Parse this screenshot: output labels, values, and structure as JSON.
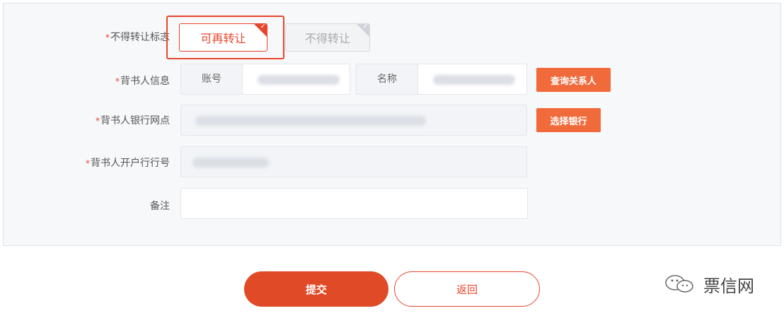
{
  "form": {
    "transfer_flag": {
      "label": "不得转让标志",
      "options": [
        "可再转让",
        "不得转让"
      ],
      "selected": "可再转让"
    },
    "endorser_info": {
      "label": "背书人信息",
      "account_prefix": "账号",
      "name_prefix": "名称",
      "button": "查询关系人"
    },
    "endorser_bank": {
      "label": "背书人银行网点",
      "button": "选择银行"
    },
    "endorser_bank_no": {
      "label": "背书人开户行行号"
    },
    "remark": {
      "label": "备注"
    }
  },
  "actions": {
    "submit": "提交",
    "back": "返回"
  },
  "watermark": "票信网",
  "colors": {
    "accent": "#e8452c",
    "button_orange": "#f06a3c",
    "panel_bg": "#f7f8fa"
  }
}
